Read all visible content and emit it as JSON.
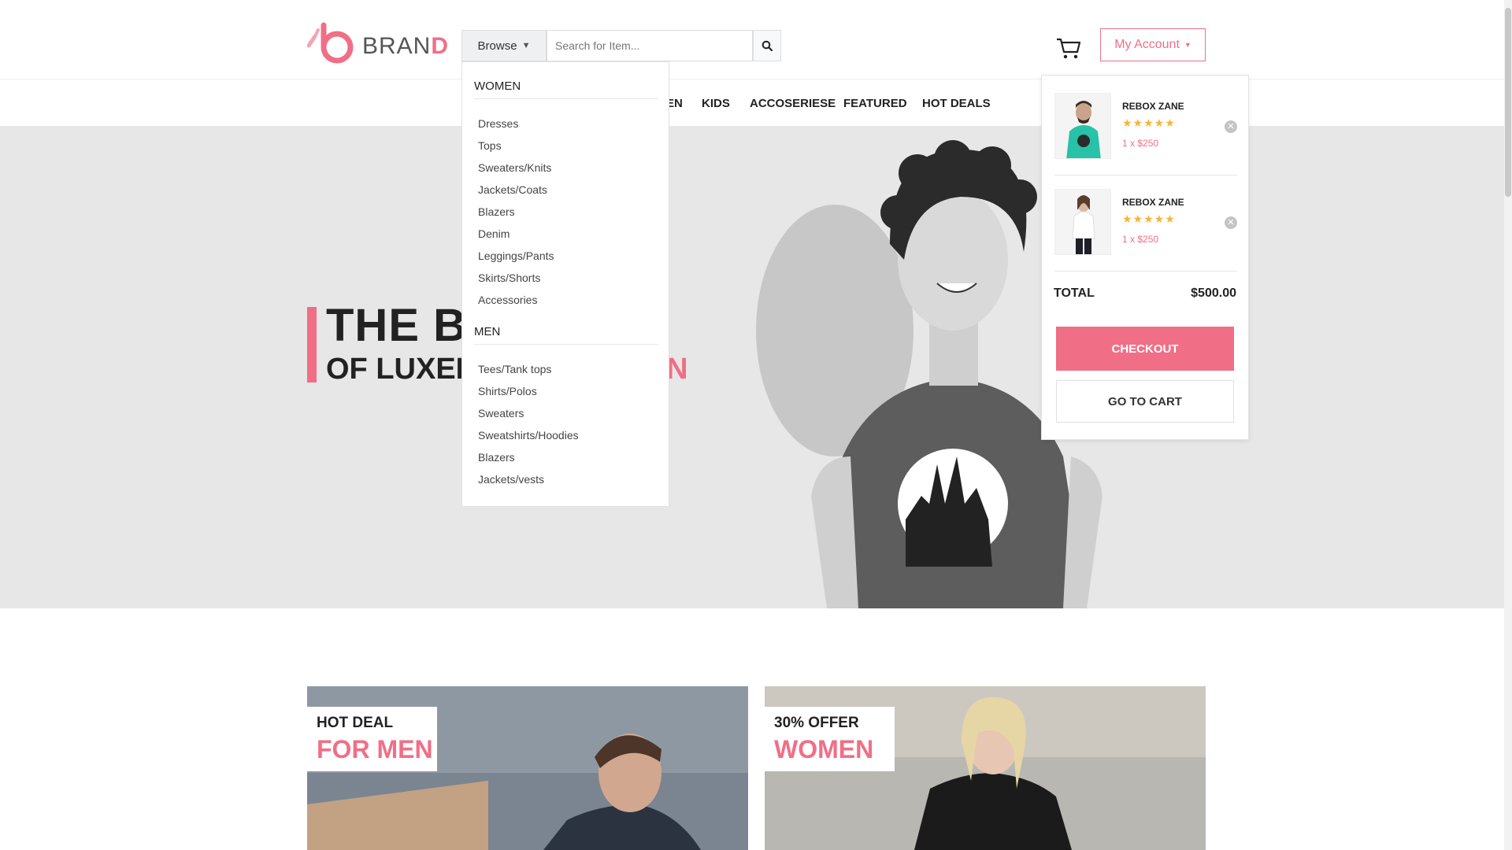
{
  "brand": {
    "name_start": "BRAN",
    "name_accent": "D",
    "accent_color": "#f06f86"
  },
  "search": {
    "browse_label": "Browse",
    "placeholder": "Search for Item..."
  },
  "header": {
    "account_label": "My Account"
  },
  "nav": {
    "items": [
      "EN",
      "KIDS",
      "ACCOSERIESE",
      "FEATURED",
      "HOT DEALS"
    ]
  },
  "hero": {
    "line1": "THE BE",
    "line2_dark": "OF LUXER",
    "line2_pink": "N"
  },
  "dropdown": {
    "sections": [
      {
        "heading": "WOMEN",
        "items": [
          "Dresses",
          "Tops",
          "Sweaters/Knits",
          "Jackets/Coats",
          "Blazers",
          "Denim",
          "Leggings/Pants",
          "Skirts/Shorts",
          "Accessories"
        ]
      },
      {
        "heading": "MEN",
        "items": [
          "Tees/Tank tops",
          "Shirts/Polos",
          "Sweaters",
          "Sweatshirts/Hoodies",
          "Blazers",
          "Jackets/vests"
        ]
      }
    ]
  },
  "cart": {
    "items": [
      {
        "name": "REBOX ZANE",
        "stars": "★★★★★",
        "rating": 4.5,
        "price": "1 x $250",
        "icon": "man-tshirt-thumbnail"
      },
      {
        "name": "REBOX ZANE",
        "stars": "★★★★★",
        "rating": 4.5,
        "price": "1 x $250",
        "icon": "woman-tshirt-thumbnail"
      }
    ],
    "total_label": "TOTAL",
    "total_value": "$500.00",
    "checkout_label": "CHECKOUT",
    "gotocart_label": "GO TO CART"
  },
  "promos": [
    {
      "small": "HOT DEAL",
      "big": "FOR MEN"
    },
    {
      "small": "30% OFFER",
      "big": "WOMEN"
    }
  ]
}
